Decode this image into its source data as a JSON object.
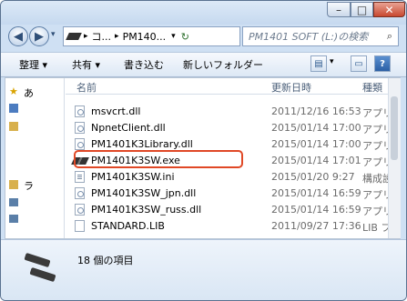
{
  "titlebar": {
    "min_icon": "minimize-icon",
    "max_icon": "maximize-icon",
    "close_icon": "close-icon"
  },
  "nav": {
    "back_glyph": "◀",
    "forward_glyph": "▶",
    "dropdown_glyph": "▾",
    "path_parts": [
      "コ...",
      "PM140..."
    ],
    "refresh_glyph": "↻",
    "search_placeholder": "PM1401 SOFT (L:)の検索"
  },
  "toolbar": {
    "organize": "整理",
    "share": "共有",
    "burn": "書き込む",
    "new_folder": "新しいフォルダー",
    "arrow": "▾"
  },
  "left_pane": {
    "items": [
      "あ",
      "ラ"
    ]
  },
  "columns": {
    "name": "名前",
    "date": "更新日時",
    "type": "種類"
  },
  "files": [
    {
      "name": "msvcrt.dll",
      "date": "2011/12/16 16:53",
      "type": "アプリ",
      "kind": "dll"
    },
    {
      "name": "NpnetClient.dll",
      "date": "2015/01/14 17:00",
      "type": "アプリ",
      "kind": "dll"
    },
    {
      "name": "PM1401K3Library.dll",
      "date": "2015/01/14 17:00",
      "type": "アプリ",
      "kind": "dll"
    },
    {
      "name": "PM1401K3SW.exe",
      "date": "2015/01/14 17:01",
      "type": "アプリ",
      "kind": "exe"
    },
    {
      "name": "PM1401K3SW.ini",
      "date": "2015/01/20 9:27",
      "type": "構成設",
      "kind": "ini"
    },
    {
      "name": "PM1401K3SW_jpn.dll",
      "date": "2015/01/14 16:59",
      "type": "アプリ",
      "kind": "dll"
    },
    {
      "name": "PM1401K3SW_russ.dll",
      "date": "2015/01/14 16:59",
      "type": "アプリ",
      "kind": "dll"
    },
    {
      "name": "STANDARD.LIB",
      "date": "2011/09/27 17:36",
      "type": "LIB ファ",
      "kind": "lib"
    }
  ],
  "status": {
    "count": "18 個の項目"
  },
  "highlight_color": "#e04826"
}
